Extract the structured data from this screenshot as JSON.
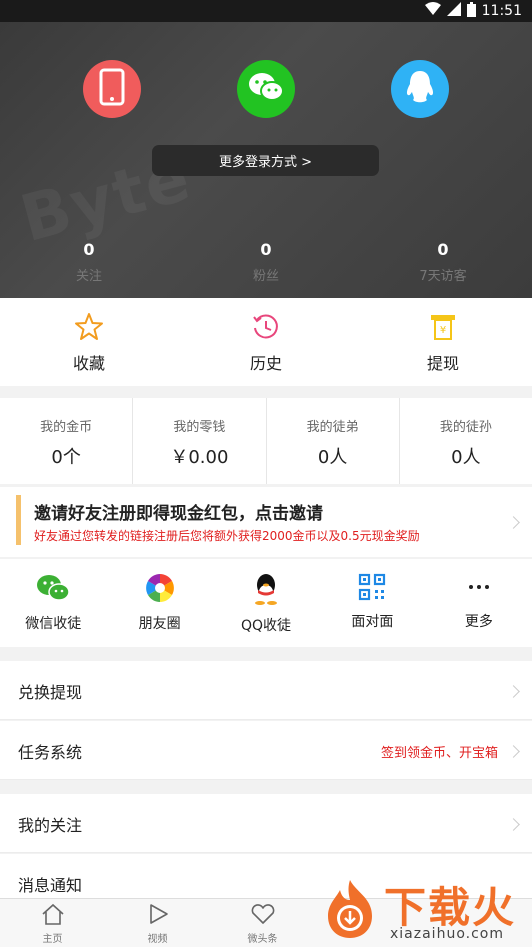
{
  "status": {
    "time": "11:51"
  },
  "header": {
    "watermark": "Byte",
    "more_login": "更多登录方式 >",
    "stats": [
      {
        "value": "0",
        "label": "关注"
      },
      {
        "value": "0",
        "label": "粉丝"
      },
      {
        "value": "0",
        "label": "7天访客"
      }
    ]
  },
  "quick": [
    {
      "label": "收藏",
      "icon": "star-icon"
    },
    {
      "label": "历史",
      "icon": "history-icon"
    },
    {
      "label": "提现",
      "icon": "withdraw-icon"
    }
  ],
  "wallet": [
    {
      "title": "我的金币",
      "value": "0个"
    },
    {
      "title": "我的零钱",
      "value": "￥0.00"
    },
    {
      "title": "我的徒弟",
      "value": "0人"
    },
    {
      "title": "我的徒孙",
      "value": "0人"
    }
  ],
  "invite": {
    "title": "邀请好友注册即得现金红包，点击邀请",
    "subtitle": "好友通过您转发的链接注册后您将额外获得2000金币以及0.5元现金奖励"
  },
  "share": [
    {
      "label": "微信收徒",
      "icon": "wechat-icon"
    },
    {
      "label": "朋友圈",
      "icon": "moments-icon"
    },
    {
      "label": "QQ收徒",
      "icon": "qq-icon"
    },
    {
      "label": "面对面",
      "icon": "qrcode-icon"
    },
    {
      "label": "更多",
      "icon": "more-icon"
    }
  ],
  "rows": [
    {
      "label": "兑换提现",
      "extra": ""
    },
    {
      "label": "任务系统",
      "extra": "签到领金币、开宝箱"
    },
    {
      "label": "我的关注",
      "extra": ""
    },
    {
      "label": "消息通知",
      "extra": ""
    }
  ],
  "tabs": [
    {
      "label": "主页",
      "icon": "home-icon"
    },
    {
      "label": "视频",
      "icon": "play-icon"
    },
    {
      "label": "微头条",
      "icon": "heart-icon"
    }
  ],
  "watermark_logo": {
    "big": "下载火",
    "small": "xiazaihuo.com"
  },
  "colors": {
    "phone": "#f05c5c",
    "wechat": "#22c322",
    "qq": "#2fb2f5",
    "red_text": "#e02020",
    "orange": "#f0702a"
  }
}
